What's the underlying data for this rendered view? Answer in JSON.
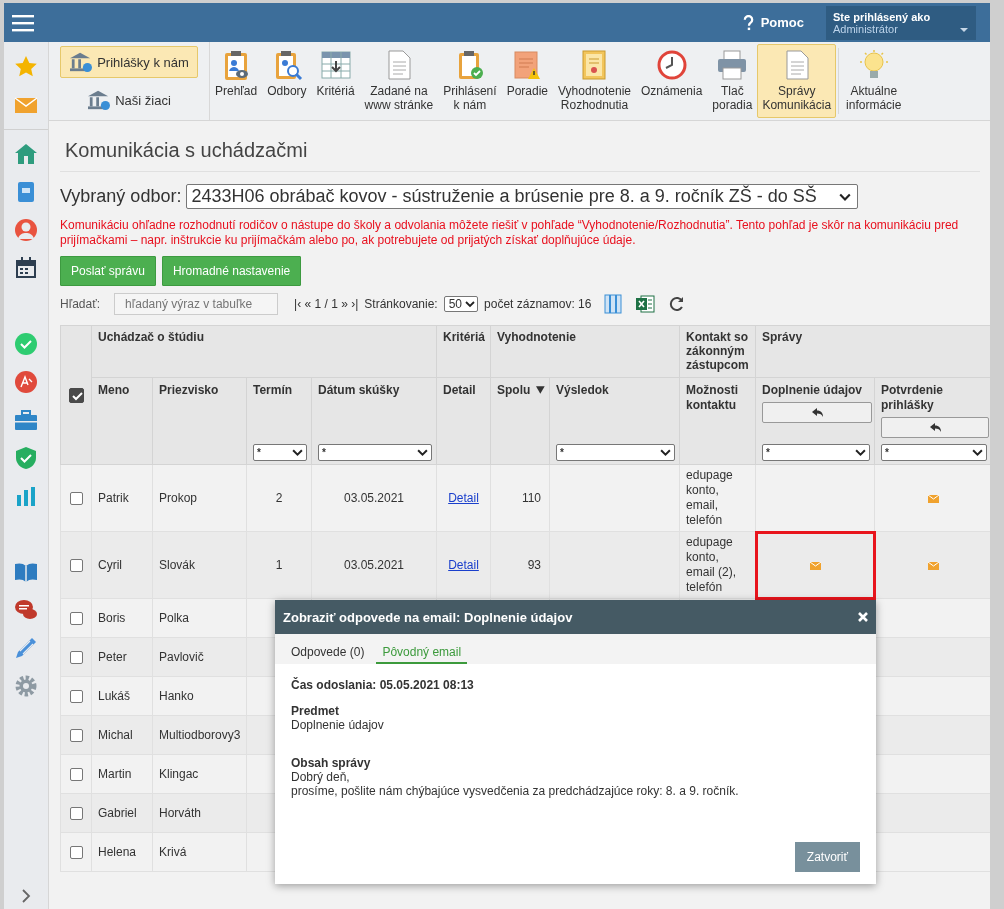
{
  "header": {
    "help": "Pomoc",
    "user_label": "Ste prihlásený ako",
    "user_name": "Administrátor"
  },
  "toolbar": {
    "side_buttons": [
      {
        "label": "Prihlášky k nám",
        "selected": true
      },
      {
        "label": "Naši žiaci",
        "selected": false
      }
    ],
    "items": [
      {
        "label": "Prehľad",
        "selected": false
      },
      {
        "label": "Odbory",
        "selected": false
      },
      {
        "label": "Kritériá",
        "selected": false
      },
      {
        "label": "Zadané na\nwww stránke",
        "selected": false
      },
      {
        "label": "Prihlásení\nk nám",
        "selected": false
      },
      {
        "label": "Poradie",
        "selected": false
      },
      {
        "label": "Vyhodnotenie\nRozhodnutia",
        "selected": false
      },
      {
        "label": "Oznámenia",
        "selected": false
      },
      {
        "label": "Tlač\nporadia",
        "selected": false
      },
      {
        "label": "Správy\nKomunikácia",
        "selected": true
      },
      {
        "label": "Aktuálne\ninformácie",
        "selected": false
      }
    ]
  },
  "page": {
    "title": "Komunikácia s uchádzačmi",
    "field_label": "Vybraný odbor:",
    "field_value": "2433H06 obrábač kovov - sústruženie a brúsenie pre 8. a 9. ročník ZŠ - do SŠ",
    "notice": "Komunikáciu ohľadne rozhodnutí rodičov o nástupe do školy a odvolania môžete riešiť v pohľade “Vyhodnotenie/Rozhodnutia”. Tento pohľad je skôr na komunikáciu pred prijímačkami – napr. inštrukcie ku prijímačkám alebo po, ak potrebujete od prijatých získať doplňujúce údaje.",
    "buttons": [
      "Poslať správu",
      "Hromadné nastavenie"
    ],
    "search": {
      "label": "Hľadať:",
      "placeholder": "hľadaný výraz v tabuľke"
    },
    "pager": "|‹ « 1 / 1 » ›|",
    "paging_label": "Stránkovanie:",
    "paging_value": "50",
    "count": "počet záznamov: 16"
  },
  "table": {
    "all_checked": true,
    "groups": [
      {
        "label": "Uchádzač o štúdiu"
      },
      {
        "label": "Kritériá"
      },
      {
        "label": "Vyhodnotenie"
      },
      {
        "label": "Kontakt so zákonným zástupcom"
      },
      {
        "label": "Správy"
      }
    ],
    "columns": [
      {
        "label": "Meno",
        "kind": "plain"
      },
      {
        "label": "Priezvisko",
        "kind": "plain"
      },
      {
        "label": "Termín",
        "kind": "filter",
        "filter": "*"
      },
      {
        "label": "Dátum skúšky",
        "kind": "filter",
        "filter": "*"
      },
      {
        "label": "Detail",
        "kind": "plain"
      },
      {
        "label": "Spolu",
        "kind": "plain",
        "sorted": true
      },
      {
        "label": "Výsledok",
        "kind": "filter",
        "filter": "*"
      },
      {
        "label": "Možnosti kontaktu",
        "kind": "plain"
      },
      {
        "label": "Doplnenie údajov",
        "kind": "reply",
        "filter": "*"
      },
      {
        "label": "Potvrdenie prihlášky",
        "kind": "reply",
        "filter": "*"
      }
    ],
    "rows": [
      {
        "selected": false,
        "first": "Patrik",
        "last": "Prokop",
        "term": "2",
        "date": "03.05.2021",
        "detail": "Detail",
        "total": "110",
        "contact": "edupage konto, email, telefón",
        "supplement_email": false,
        "confirm_email": true,
        "highlighted": false
      },
      {
        "selected": false,
        "first": "Cyril",
        "last": "Slovák",
        "term": "1",
        "date": "03.05.2021",
        "detail": "Detail",
        "total": "93",
        "contact": "edupage konto, email (2), telefón",
        "supplement_email": true,
        "confirm_email": true,
        "highlighted": true
      },
      {
        "selected": false,
        "first": "Boris",
        "last": "Polka"
      },
      {
        "selected": false,
        "first": "Peter",
        "last": "Pavlovič"
      },
      {
        "selected": false,
        "first": "Lukáš",
        "last": "Hanko"
      },
      {
        "selected": false,
        "first": "Michal",
        "last": "Multiodborovy3"
      },
      {
        "selected": false,
        "first": "Martin",
        "last": "Klingac"
      },
      {
        "selected": false,
        "first": "Gabriel",
        "last": "Horváth"
      },
      {
        "selected": false,
        "first": "Helena",
        "last": "Krivá"
      }
    ]
  },
  "modal": {
    "title": "Zobraziť odpovede na email: Doplnenie údajov",
    "tabs": [
      {
        "label": "Odpovede (0)",
        "selected": false
      },
      {
        "label": "Pôvodný email",
        "selected": true
      }
    ],
    "sent": "Čas odoslania: 05.05.2021 08:13",
    "subject_label": "Predmet",
    "subject": "Doplnenie údajov",
    "body_label": "Obsah správy",
    "body": [
      "Dobrý deň,",
      "prosíme, pošlite nám chýbajúce vysvedčenia za predchádzajúce roky: 8. a 9. ročník."
    ],
    "close": "Zatvoriť"
  }
}
